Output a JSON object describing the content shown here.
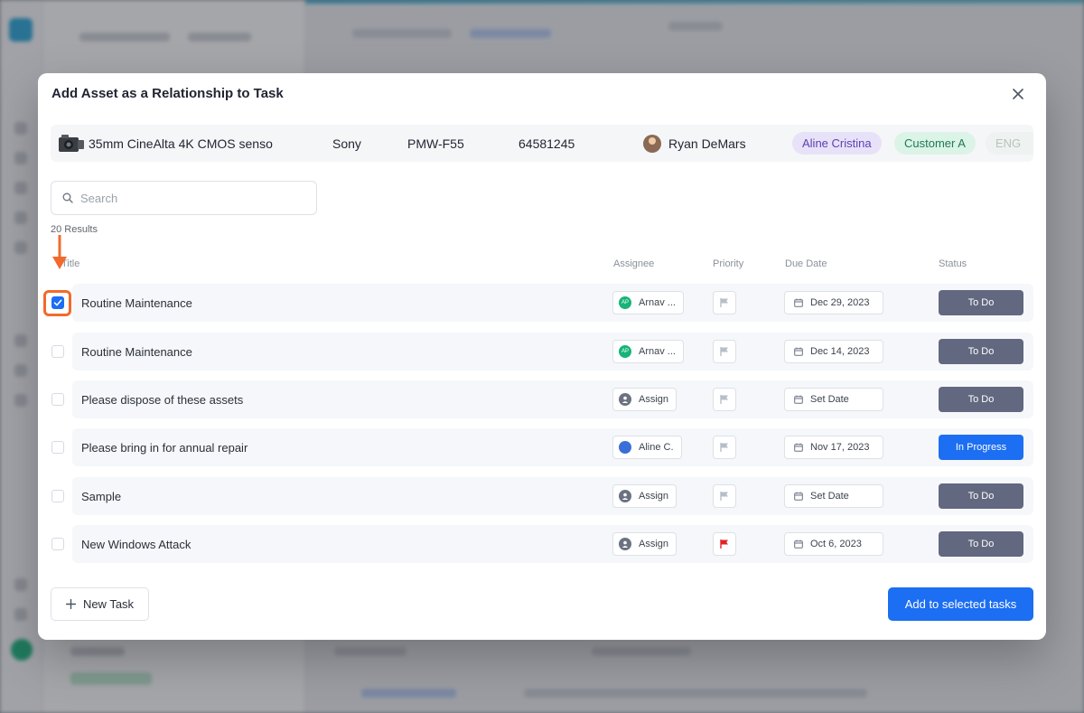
{
  "modal": {
    "title": "Add Asset as a Relationship to Task",
    "close_icon": "close-icon"
  },
  "asset": {
    "name": "35mm CineAlta 4K CMOS senso",
    "make": "Sony",
    "model": "PMW-F55",
    "serial": "64581245",
    "owner": "Ryan DeMars",
    "tags": [
      "Aline Cristina",
      "Customer A",
      "ENG"
    ]
  },
  "search": {
    "placeholder": "Search",
    "value": ""
  },
  "results_label": "20 Results",
  "columns": {
    "title": "Title",
    "assignee": "Assignee",
    "priority": "Priority",
    "due_date": "Due Date",
    "status": "Status"
  },
  "tasks": [
    {
      "checked": true,
      "title": "Routine Maintenance",
      "assignee": "Arnav ...",
      "assignee_initials": "AP",
      "assignee_type": "initials",
      "priority_color": "#b8bec8",
      "due": "Dec 29, 2023",
      "status": "To Do"
    },
    {
      "checked": false,
      "title": "Routine Maintenance",
      "assignee": "Arnav ...",
      "assignee_initials": "AP",
      "assignee_type": "initials",
      "priority_color": "#b8bec8",
      "due": "Dec 14, 2023",
      "status": "To Do"
    },
    {
      "checked": false,
      "title": "Please dispose of these assets",
      "assignee": "Assign",
      "assignee_initials": "",
      "assignee_type": "empty",
      "priority_color": "#b8bec8",
      "due": "Set Date",
      "status": "To Do"
    },
    {
      "checked": false,
      "title": "Please bring in for annual repair",
      "assignee": "Aline C.",
      "assignee_initials": "",
      "assignee_type": "photo",
      "priority_color": "#b8bec8",
      "due": "Nov 17, 2023",
      "status": "In Progress"
    },
    {
      "checked": false,
      "title": "Sample",
      "assignee": "Assign",
      "assignee_initials": "",
      "assignee_type": "empty",
      "priority_color": "#b8bec8",
      "due": "Set Date",
      "status": "To Do"
    },
    {
      "checked": false,
      "title": "New Windows Attack",
      "assignee": "Assign",
      "assignee_initials": "",
      "assignee_type": "empty",
      "priority_color": "#e02424",
      "due": "Oct 6, 2023",
      "status": "To Do"
    }
  ],
  "footer": {
    "new_task_label": "New Task",
    "add_label": "Add to selected tasks"
  },
  "colors": {
    "primary": "#1c6ef2",
    "status_todo": "#62687f",
    "annotation": "#f26a2c"
  }
}
